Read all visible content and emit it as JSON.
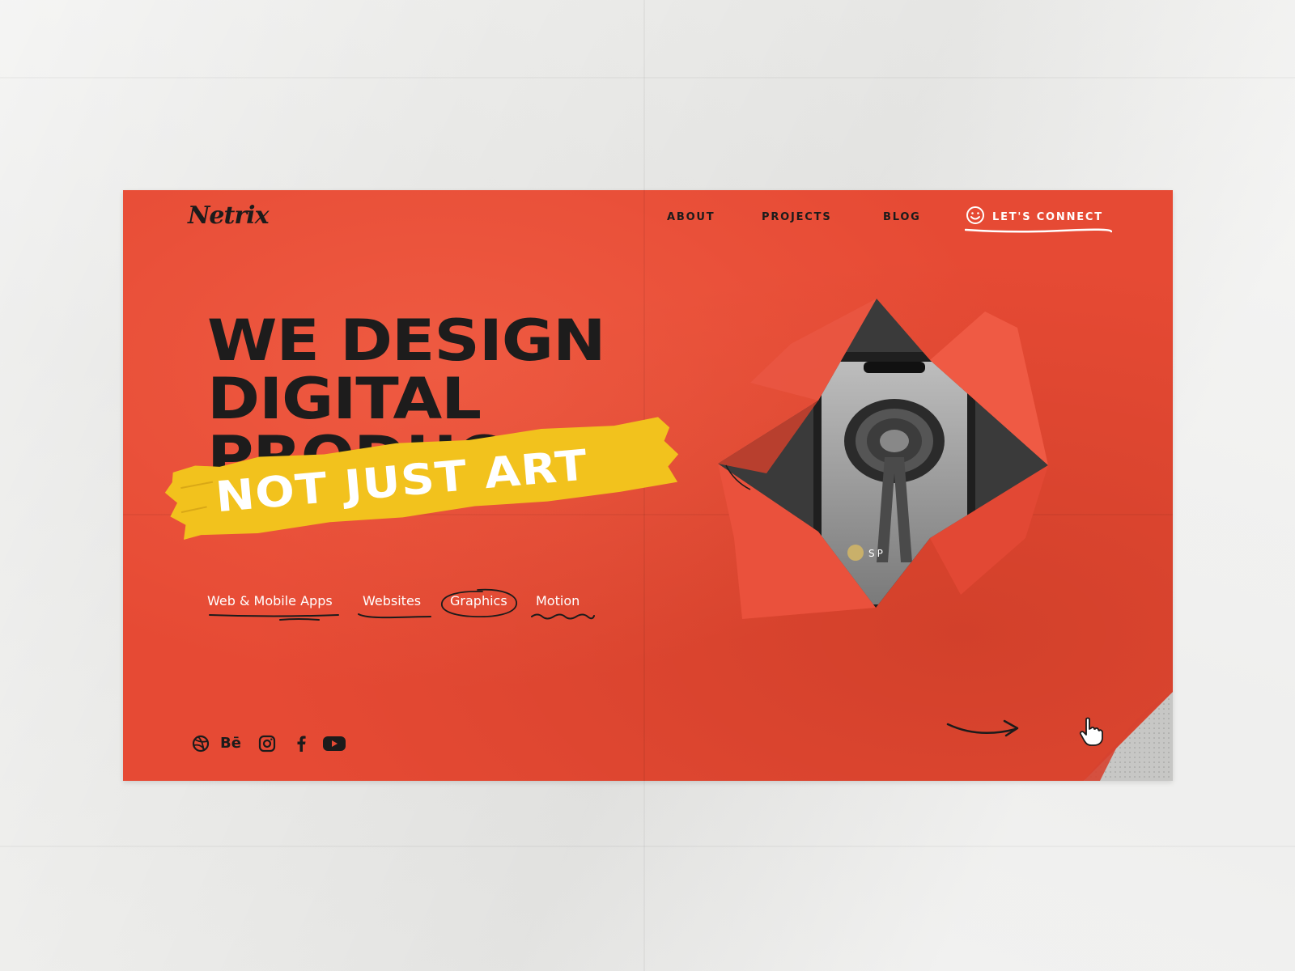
{
  "brand": {
    "logo": "Netrix"
  },
  "nav": {
    "items": [
      {
        "label": "ABOUT"
      },
      {
        "label": "PROJECTS"
      },
      {
        "label": "BLOG"
      }
    ],
    "cta": {
      "label": "LET'S CONNECT",
      "icon": "smiley-icon"
    }
  },
  "hero": {
    "headline": [
      "WE DESIGN",
      "DIGITAL",
      "PRODUCTS"
    ],
    "tape_text": "NOT JUST ART",
    "art_caption": "SP"
  },
  "services": [
    {
      "label": "Web & Mobile Apps"
    },
    {
      "label": "Websites"
    },
    {
      "label": "Graphics"
    },
    {
      "label": "Motion"
    }
  ],
  "socials": [
    {
      "icon": "dribbble-icon"
    },
    {
      "icon": "behance-icon",
      "text": "Bē"
    },
    {
      "icon": "instagram-icon"
    },
    {
      "icon": "facebook-icon"
    },
    {
      "icon": "youtube-icon"
    }
  ],
  "colors": {
    "poster_bg": "#e64a34",
    "ink": "#1c1b1b",
    "tape": "#f2c21d",
    "text_light": "#ffffff",
    "page_bg": "#e9e9e7"
  }
}
